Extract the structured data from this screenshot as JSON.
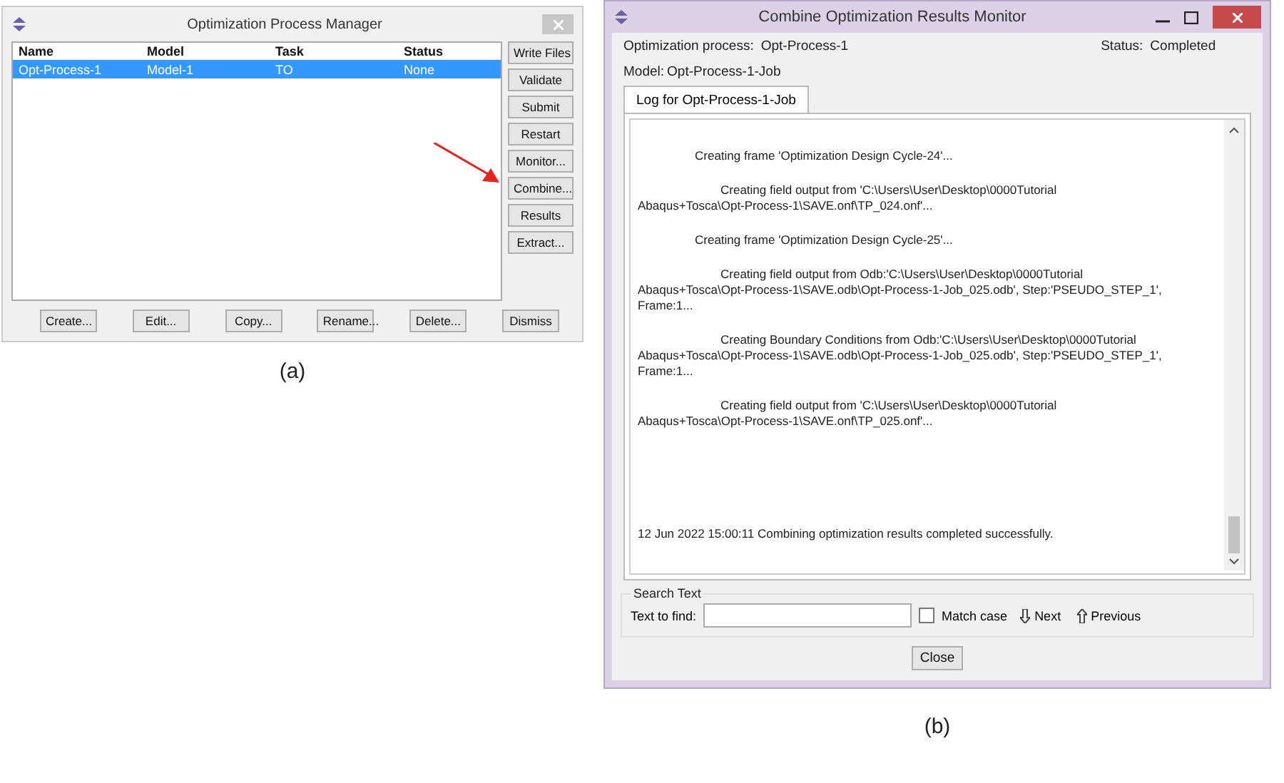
{
  "manager": {
    "title": "Optimization Process Manager",
    "columns": [
      "Name",
      "Model",
      "Task",
      "Status"
    ],
    "rows": [
      {
        "cells": [
          "Opt-Process-1",
          "Model-1",
          "TO",
          "None"
        ],
        "selected": true
      }
    ],
    "side_buttons": [
      "Write Files",
      "Validate",
      "Submit",
      "Restart",
      "Monitor...",
      "Combine...",
      "Results",
      "Extract..."
    ],
    "bottom_buttons": [
      "Create...",
      "Edit...",
      "Copy...",
      "Rename...",
      "Delete...",
      "Dismiss"
    ],
    "caption": "(a)"
  },
  "monitor": {
    "title": "Combine Optimization Results Monitor",
    "process_label": "Optimization process:",
    "process_value": "Opt-Process-1",
    "status_label": "Status:",
    "status_value": "Completed",
    "model_label": "Model:",
    "model_value": "Opt-Process-1-Job",
    "tabs": [
      {
        "label": "Log for Opt-Process-1-Job",
        "selected": true
      }
    ],
    "log": [
      {
        "kind": "frame",
        "lines": [
          "Creating frame 'Optimization Design Cycle-24'..."
        ]
      },
      {
        "kind": "detail",
        "lines": [
          "Creating field output from 'C:\\Users\\User\\Desktop\\0000Tutorial",
          "Abaqus+Tosca\\Opt-Process-1\\SAVE.onf\\TP_024.onf'..."
        ]
      },
      {
        "kind": "frame",
        "lines": [
          "Creating frame 'Optimization Design Cycle-25'..."
        ]
      },
      {
        "kind": "detail",
        "lines": [
          "Creating field output from Odb:'C:\\Users\\User\\Desktop\\0000Tutorial",
          "Abaqus+Tosca\\Opt-Process-1\\SAVE.odb\\Opt-Process-1-Job_025.odb', Step:'PSEUDO_STEP_1',",
          "Frame:1..."
        ]
      },
      {
        "kind": "detail",
        "lines": [
          "Creating Boundary Conditions from Odb:'C:\\Users\\User\\Desktop\\0000Tutorial",
          "Abaqus+Tosca\\Opt-Process-1\\SAVE.odb\\Opt-Process-1-Job_025.odb', Step:'PSEUDO_STEP_1',",
          "Frame:1..."
        ]
      },
      {
        "kind": "detail",
        "lines": [
          "Creating field output from 'C:\\Users\\User\\Desktop\\0000Tutorial",
          "Abaqus+Tosca\\Opt-Process-1\\SAVE.onf\\TP_025.onf'..."
        ]
      },
      {
        "kind": "summary",
        "lines": [
          "12 Jun 2022 15:00:11 Combining optimization results completed successfully."
        ]
      }
    ],
    "search": {
      "title": "Search Text",
      "label": "Text to find:",
      "match_case": {
        "label": "Match case",
        "checked": false
      },
      "next": "Next",
      "previous": "Previous"
    },
    "close": "Close",
    "caption": "(b)"
  }
}
